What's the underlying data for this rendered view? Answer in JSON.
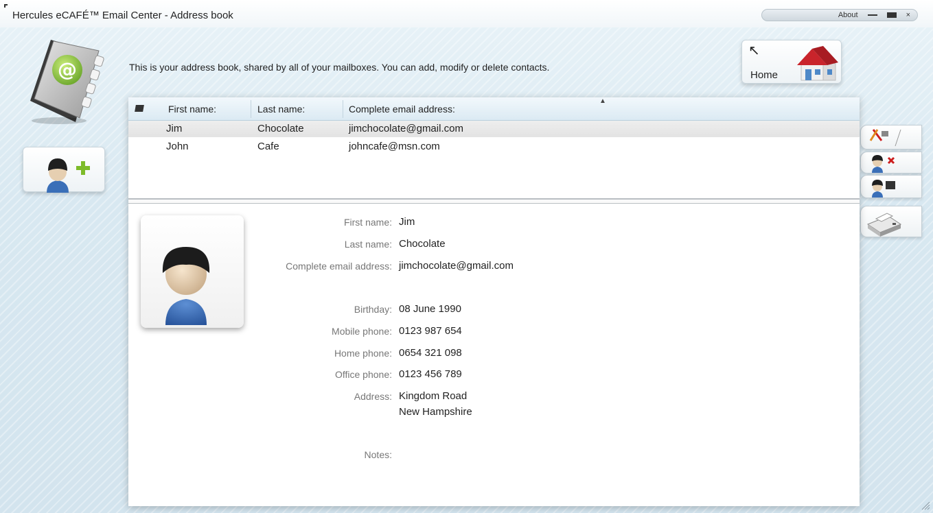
{
  "window": {
    "title": "Hercules eCAFÉ™ Email Center - Address book",
    "about_label": "About",
    "minimize_icon": "minimize-icon",
    "maximize_icon": "maximize-icon",
    "close_label": "×"
  },
  "intro_text": "This is your address book, shared by all of your mailboxes. You can add, modify or delete contacts.",
  "home": {
    "label": "Home",
    "arrow": "↖"
  },
  "table": {
    "headers": {
      "first": "First name:",
      "last": "Last name:",
      "email": "Complete email address:"
    },
    "rows": [
      {
        "first": "Jim",
        "last": "Chocolate",
        "email": "jimchocolate@gmail.com"
      },
      {
        "first": "John",
        "last": "Cafe",
        "email": "johncafe@msn.com"
      }
    ],
    "selected_index": 0
  },
  "details": {
    "first_name_label": "First name:",
    "first_name": "Jim",
    "last_name_label": "Last name:",
    "last_name": "Chocolate",
    "email_label": "Complete email address:",
    "email": "jimchocolate@gmail.com",
    "birthday_label": "Birthday:",
    "birthday": "08 June 1990",
    "mobile_label": "Mobile phone:",
    "mobile": "0123 987 654",
    "home_phone_label": "Home phone:",
    "home_phone": "0654 321 098",
    "office_phone_label": "Office phone:",
    "office_phone": "0123 456 789",
    "address_label": "Address:",
    "address_line1": "Kingdom Road",
    "address_line2": "New Hampshire",
    "notes_label": "Notes:"
  },
  "icons": {
    "address_book": "address-book-icon",
    "add_contact": "add-contact-icon",
    "edit_contact": "edit-contact-icon",
    "delete_contact": "delete-contact-icon",
    "contact_list": "contact-card-icon",
    "print": "printer-icon",
    "home": "house-icon"
  },
  "colors": {
    "accent_green": "#7dbb2a",
    "delete_red": "#cc1d1d",
    "house_roof": "#c9242b",
    "avatar_shirt": "#3a6fb8",
    "background": "#d8e8f1"
  }
}
